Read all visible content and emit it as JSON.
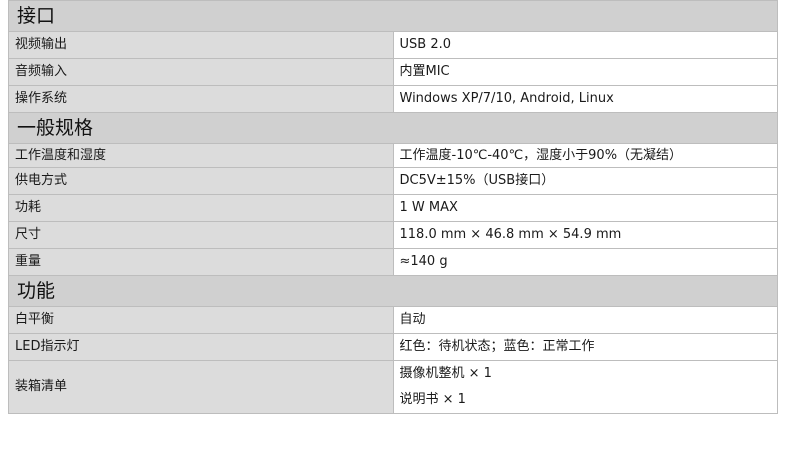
{
  "sections": [
    {
      "title": "接口",
      "rows": [
        {
          "label": "视频输出",
          "value": "USB 2.0"
        },
        {
          "label": "音频输入",
          "value": "内置MIC"
        },
        {
          "label": "操作系统",
          "value": "Windows XP/7/10, Android, Linux"
        }
      ]
    },
    {
      "title": "一般规格",
      "rows": [
        {
          "label": "工作温度和湿度",
          "value": "工作温度-10℃-40℃，湿度小于90%（无凝结）"
        },
        {
          "label": "供电方式",
          "value": "DC5V±15%（USB接口）"
        },
        {
          "label": "功耗",
          "value": "1 W MAX"
        },
        {
          "label": "尺寸",
          "value": "118.0 mm × 46.8 mm × 54.9 mm"
        },
        {
          "label": "重量",
          "value": "≈140 g"
        }
      ]
    },
    {
      "title": "功能",
      "rows": [
        {
          "label": "白平衡",
          "value": "自动"
        },
        {
          "label": "LED指示灯",
          "value": "红色：待机状态；蓝色：正常工作"
        },
        {
          "label": "装箱清单",
          "value_lines": [
            "摄像机整机 × 1",
            "说明书 × 1"
          ]
        }
      ]
    }
  ]
}
